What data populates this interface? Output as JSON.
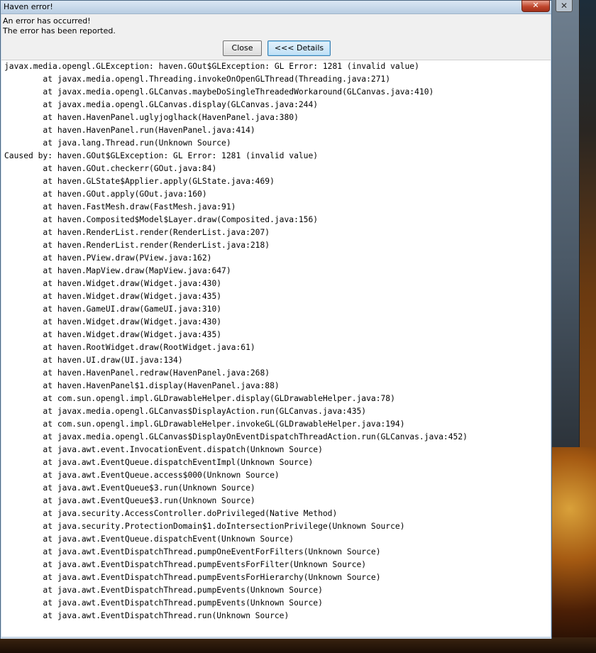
{
  "dialog": {
    "title": "Haven error!",
    "message_line1": "An error has occurred!",
    "message_line2": "The error has been reported.",
    "close_label": "Close",
    "details_label": "<<< Details"
  },
  "stack_trace": [
    "javax.media.opengl.GLException: haven.GOut$GLException: GL Error: 1281 (invalid value)",
    "        at javax.media.opengl.Threading.invokeOnOpenGLThread(Threading.java:271)",
    "        at javax.media.opengl.GLCanvas.maybeDoSingleThreadedWorkaround(GLCanvas.java:410)",
    "        at javax.media.opengl.GLCanvas.display(GLCanvas.java:244)",
    "        at haven.HavenPanel.uglyjoglhack(HavenPanel.java:380)",
    "        at haven.HavenPanel.run(HavenPanel.java:414)",
    "        at java.lang.Thread.run(Unknown Source)",
    "Caused by: haven.GOut$GLException: GL Error: 1281 (invalid value)",
    "        at haven.GOut.checkerr(GOut.java:84)",
    "        at haven.GLState$Applier.apply(GLState.java:469)",
    "        at haven.GOut.apply(GOut.java:160)",
    "        at haven.FastMesh.draw(FastMesh.java:91)",
    "        at haven.Composited$Model$Layer.draw(Composited.java:156)",
    "        at haven.RenderList.render(RenderList.java:207)",
    "        at haven.RenderList.render(RenderList.java:218)",
    "        at haven.PView.draw(PView.java:162)",
    "        at haven.MapView.draw(MapView.java:647)",
    "        at haven.Widget.draw(Widget.java:430)",
    "        at haven.Widget.draw(Widget.java:435)",
    "        at haven.GameUI.draw(GameUI.java:310)",
    "        at haven.Widget.draw(Widget.java:430)",
    "        at haven.Widget.draw(Widget.java:435)",
    "        at haven.RootWidget.draw(RootWidget.java:61)",
    "        at haven.UI.draw(UI.java:134)",
    "        at haven.HavenPanel.redraw(HavenPanel.java:268)",
    "        at haven.HavenPanel$1.display(HavenPanel.java:88)",
    "        at com.sun.opengl.impl.GLDrawableHelper.display(GLDrawableHelper.java:78)",
    "        at javax.media.opengl.GLCanvas$DisplayAction.run(GLCanvas.java:435)",
    "        at com.sun.opengl.impl.GLDrawableHelper.invokeGL(GLDrawableHelper.java:194)",
    "        at javax.media.opengl.GLCanvas$DisplayOnEventDispatchThreadAction.run(GLCanvas.java:452)",
    "        at java.awt.event.InvocationEvent.dispatch(Unknown Source)",
    "        at java.awt.EventQueue.dispatchEventImpl(Unknown Source)",
    "        at java.awt.EventQueue.access$000(Unknown Source)",
    "        at java.awt.EventQueue$3.run(Unknown Source)",
    "        at java.awt.EventQueue$3.run(Unknown Source)",
    "        at java.security.AccessController.doPrivileged(Native Method)",
    "        at java.security.ProtectionDomain$1.doIntersectionPrivilege(Unknown Source)",
    "        at java.awt.EventQueue.dispatchEvent(Unknown Source)",
    "        at java.awt.EventDispatchThread.pumpOneEventForFilters(Unknown Source)",
    "        at java.awt.EventDispatchThread.pumpEventsForFilter(Unknown Source)",
    "        at java.awt.EventDispatchThread.pumpEventsForHierarchy(Unknown Source)",
    "        at java.awt.EventDispatchThread.pumpEvents(Unknown Source)",
    "        at java.awt.EventDispatchThread.pumpEvents(Unknown Source)",
    "        at java.awt.EventDispatchThread.run(Unknown Source)"
  ],
  "icons": {
    "dialog_close": "close-icon",
    "background_close": "close-icon"
  },
  "colors": {
    "dialog_frame": "#c9d7e6",
    "close_button": "#c0462c",
    "details_button": "#bfe0f6"
  }
}
